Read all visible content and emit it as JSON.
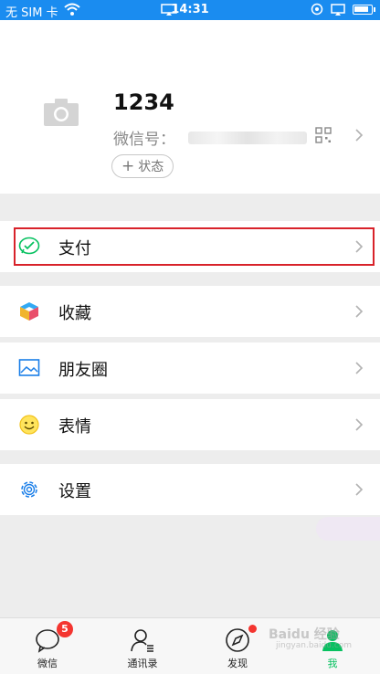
{
  "status_bar": {
    "carrier": "无 SIM 卡",
    "time": "14:31"
  },
  "profile": {
    "nickname": "1234",
    "wxid_label": "微信号：",
    "status_button": "状态"
  },
  "menu": [
    {
      "label": "支付",
      "icon": "wechat-pay-icon"
    },
    {
      "label": "收藏",
      "icon": "favorites-cube-icon"
    },
    {
      "label": "朋友圈",
      "icon": "moments-photo-icon"
    },
    {
      "label": "表情",
      "icon": "sticker-smile-icon"
    },
    {
      "label": "设置",
      "icon": "settings-gear-icon"
    }
  ],
  "tabbar": [
    {
      "label": "微信",
      "badge": "5"
    },
    {
      "label": "通讯录"
    },
    {
      "label": "发现"
    },
    {
      "label": "我"
    }
  ],
  "watermark": {
    "text": "Baidu 经验",
    "url": "jingyan.baidu.com"
  },
  "colors": {
    "status_bar": "#1a8cf0",
    "highlight": "#d8222a",
    "badge": "#f43530",
    "active_tab": "#07c160"
  }
}
